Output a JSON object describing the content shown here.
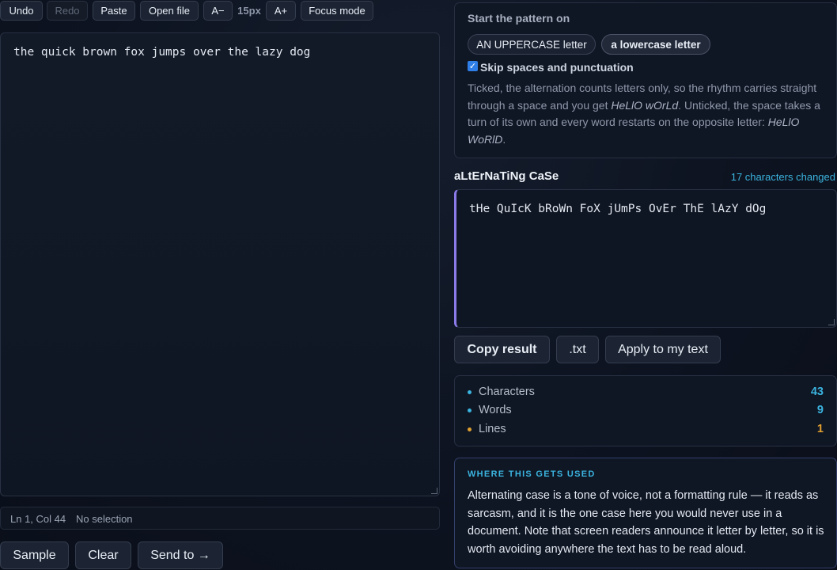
{
  "toolbar": {
    "undo": "Undo",
    "redo": "Redo",
    "paste": "Paste",
    "open_file": "Open file",
    "font_down": "A−",
    "font_size": "15px",
    "font_up": "A+",
    "focus_mode": "Focus mode"
  },
  "editor": {
    "text": "the quick brown fox jumps over the lazy dog"
  },
  "status": {
    "position": "Ln 1, Col 44",
    "selection": "No selection"
  },
  "bottom_actions": {
    "sample": "Sample",
    "clear": "Clear",
    "send_to": "Send to →"
  },
  "pattern": {
    "heading": "Start the pattern on",
    "option_upper": "AN UPPERCASE letter",
    "option_lower": "a lowercase letter",
    "selected": "a lowercase letter",
    "skip_label": "Skip spaces and punctuation",
    "skip_checked": true,
    "explain_1": "Ticked, the alternation counts letters only, so the rhythm carries straight through a space and you get ",
    "example_1": "HeLlO wOrLd",
    "explain_2": ". Unticked, the space takes a turn of its own and every word restarts on the opposite letter: ",
    "example_2": "HeLlO WoRlD",
    "explain_3": "."
  },
  "result": {
    "title": "aLtErNaTiNg CaSe",
    "changed": "17 characters changed",
    "text": "tHe QuIcK bRoWn FoX jUmPs OvEr ThE lAzY dOg"
  },
  "result_actions": {
    "copy": "Copy result",
    "txt": ".txt",
    "apply": "Apply to my text"
  },
  "stats": [
    {
      "label": "Characters",
      "value": "43",
      "color": "#3bb4df"
    },
    {
      "label": "Words",
      "value": "9",
      "color": "#3bb4df"
    },
    {
      "label": "Lines",
      "value": "1",
      "color": "#e0a030"
    }
  ],
  "info": {
    "heading": "WHERE THIS GETS USED",
    "body": "Alternating case is a tone of voice, not a formatting rule — it reads as sarcasm, and it is the one case here you would never use in a document. Note that screen readers announce it letter by letter, so it is worth avoiding anywhere the text has to be read aloud."
  }
}
